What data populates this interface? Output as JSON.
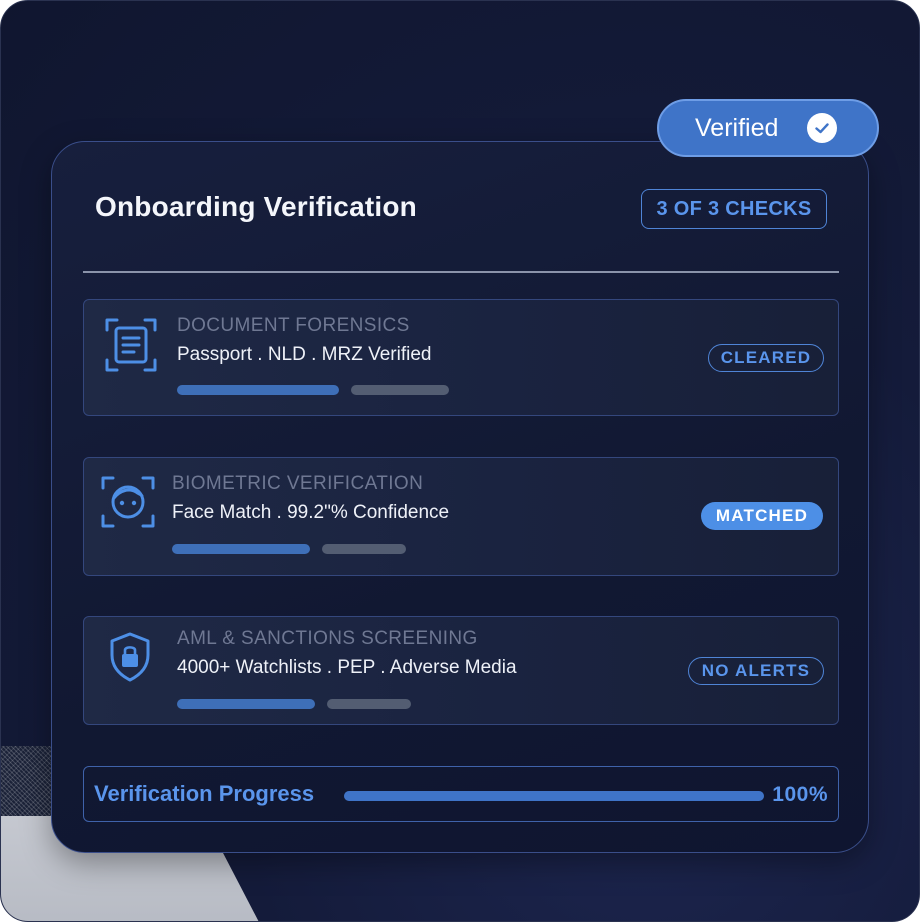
{
  "badge": {
    "label": "Verified"
  },
  "header": {
    "title": "Onboarding Verification",
    "checks": "3 OF 3 CHECKS"
  },
  "checks": [
    {
      "label": "DOCUMENT FORENSICS",
      "value": "Passport . NLD .  MRZ Verified",
      "status": "CLEARED",
      "icon": "document-scan-icon"
    },
    {
      "label": "BIOMETRIC VERIFICATION",
      "value": "Face Match . 99.2\"% Confidence",
      "status": "MATCHED",
      "icon": "face-scan-icon"
    },
    {
      "label": "AML & SANCTIONS SCREENING",
      "value": "4000+ Watchlists . PEP . Adverse Media",
      "status": "NO ALERTS",
      "icon": "shield-lock-icon"
    }
  ],
  "progress": {
    "label": "Verification Progress",
    "value": 100,
    "display": "100%"
  },
  "colors": {
    "accent": "#5a95ec",
    "pill": "#3f74c8",
    "card": "#111832",
    "background": "#141b3a"
  }
}
